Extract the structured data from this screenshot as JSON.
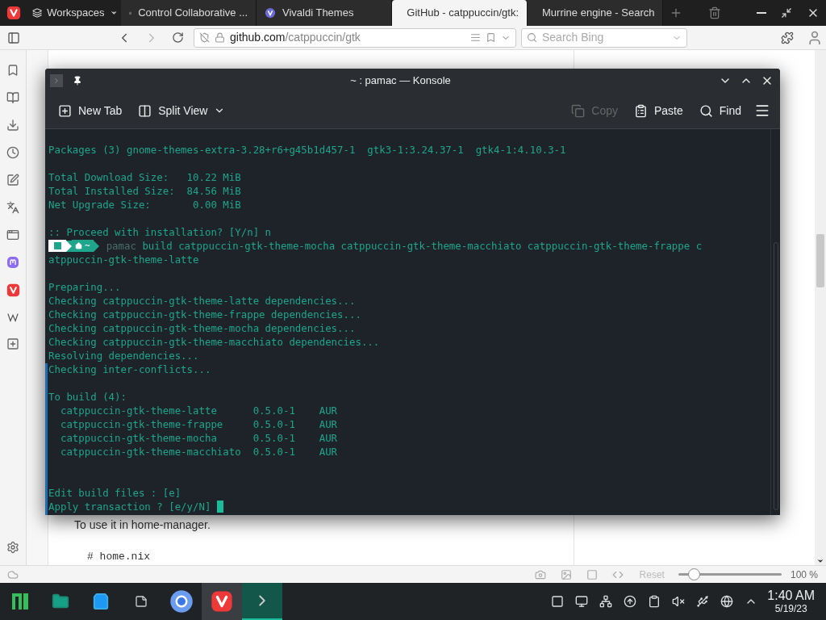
{
  "browser": {
    "workspaces": {
      "label": "Workspaces"
    },
    "tabs": [
      {
        "label": "Control Collaborative ...",
        "kind": "page",
        "selected": false
      },
      {
        "label": "Vivaldi Themes",
        "kind": "vivaldi",
        "selected": false
      },
      {
        "label": "GitHub - catppuccin/gtk:",
        "kind": "github",
        "selected": true
      },
      {
        "label": "Murrine engine - Search",
        "kind": "search",
        "selected": false
      }
    ],
    "address": {
      "domain": "github.com",
      "path": "/catppuccin/gtk"
    },
    "search": {
      "placeholder": "Search Bing"
    },
    "panel_icons": [
      {
        "kind": "bookmark"
      },
      {
        "kind": "reader"
      },
      {
        "kind": "download"
      },
      {
        "kind": "history"
      },
      {
        "kind": "notes"
      },
      {
        "kind": "translate"
      },
      {
        "kind": "window"
      },
      {
        "kind": "mastodon"
      },
      {
        "kind": "vivaldi"
      },
      {
        "kind": "wiki"
      },
      {
        "kind": "add"
      }
    ]
  },
  "page": {
    "paragraph": "To use it in home-manager.",
    "code": "# home.nix"
  },
  "konsole": {
    "title": "~ : pamac — Konsole",
    "toolbar": [
      {
        "label": "New Tab",
        "kind": "new-tab",
        "disabled": false
      },
      {
        "label": "Split View",
        "kind": "split",
        "disabled": false
      },
      {
        "label": "Copy",
        "kind": "copy",
        "disabled": true
      },
      {
        "label": "Paste",
        "kind": "paste",
        "disabled": false
      },
      {
        "label": "Find",
        "kind": "find",
        "disabled": false
      }
    ],
    "lines": [
      {
        "kind": "blank"
      },
      {
        "kind": "output",
        "text": "Packages (3) gnome-themes-extra-3.28+r6+g45b1d457-1  gtk3-1:3.24.37-1  gtk4-1:4.10.3-1"
      },
      {
        "kind": "blank"
      },
      {
        "kind": "output",
        "text": "Total Download Size:   10.22 MiB"
      },
      {
        "kind": "output",
        "text": "Total Installed Size:  84.56 MiB"
      },
      {
        "kind": "output",
        "text": "Net Upgrade Size:       0.00 MiB"
      },
      {
        "kind": "blank"
      },
      {
        "kind": "output",
        "text": ":: Proceed with installation? [Y/n] n"
      },
      {
        "kind": "prompt",
        "dir": "~",
        "program": "pamac",
        "text": "build catppuccin-gtk-theme-mocha catppuccin-gtk-theme-macchiato catppuccin-gtk-theme-frappe c"
      },
      {
        "kind": "output",
        "text": "atppuccin-gtk-theme-latte"
      },
      {
        "kind": "blank"
      },
      {
        "kind": "output",
        "text": "Preparing..."
      },
      {
        "kind": "output",
        "text": "Checking catppuccin-gtk-theme-latte dependencies..."
      },
      {
        "kind": "output",
        "text": "Checking catppuccin-gtk-theme-frappe dependencies..."
      },
      {
        "kind": "output",
        "text": "Checking catppuccin-gtk-theme-mocha dependencies..."
      },
      {
        "kind": "output",
        "text": "Checking catppuccin-gtk-theme-macchiato dependencies..."
      },
      {
        "kind": "output",
        "text": "Resolving dependencies..."
      },
      {
        "kind": "output",
        "text": "Checking inter-conflicts..."
      },
      {
        "kind": "blank"
      },
      {
        "kind": "output",
        "text": "To build (4):"
      },
      {
        "kind": "output",
        "text": "  catppuccin-gtk-theme-latte      0.5.0-1    AUR"
      },
      {
        "kind": "output",
        "text": "  catppuccin-gtk-theme-frappe     0.5.0-1    AUR"
      },
      {
        "kind": "output",
        "text": "  catppuccin-gtk-theme-mocha      0.5.0-1    AUR"
      },
      {
        "kind": "output",
        "text": "  catppuccin-gtk-theme-macchiato  0.5.0-1    AUR"
      },
      {
        "kind": "blank"
      },
      {
        "kind": "blank"
      },
      {
        "kind": "output",
        "text": "Edit build files : [e]"
      },
      {
        "kind": "input",
        "text": "Apply transaction ? [e/y/N]"
      }
    ]
  },
  "status_bar": {
    "reset": "Reset",
    "zoom": {
      "level": 0.15,
      "reading": "100 %"
    }
  },
  "taskbar": {
    "apps": [
      {
        "kind": "manjaro",
        "selected": false
      },
      {
        "kind": "files",
        "selected": false
      },
      {
        "kind": "store",
        "selected": false
      },
      {
        "kind": "notes",
        "selected": false
      },
      {
        "kind": "browser",
        "selected": false
      },
      {
        "kind": "vivaldi",
        "selected": true
      },
      {
        "kind": "terminal",
        "selected": true
      }
    ],
    "clock": {
      "time": "1:40 AM",
      "date": "5/19/23"
    }
  }
}
